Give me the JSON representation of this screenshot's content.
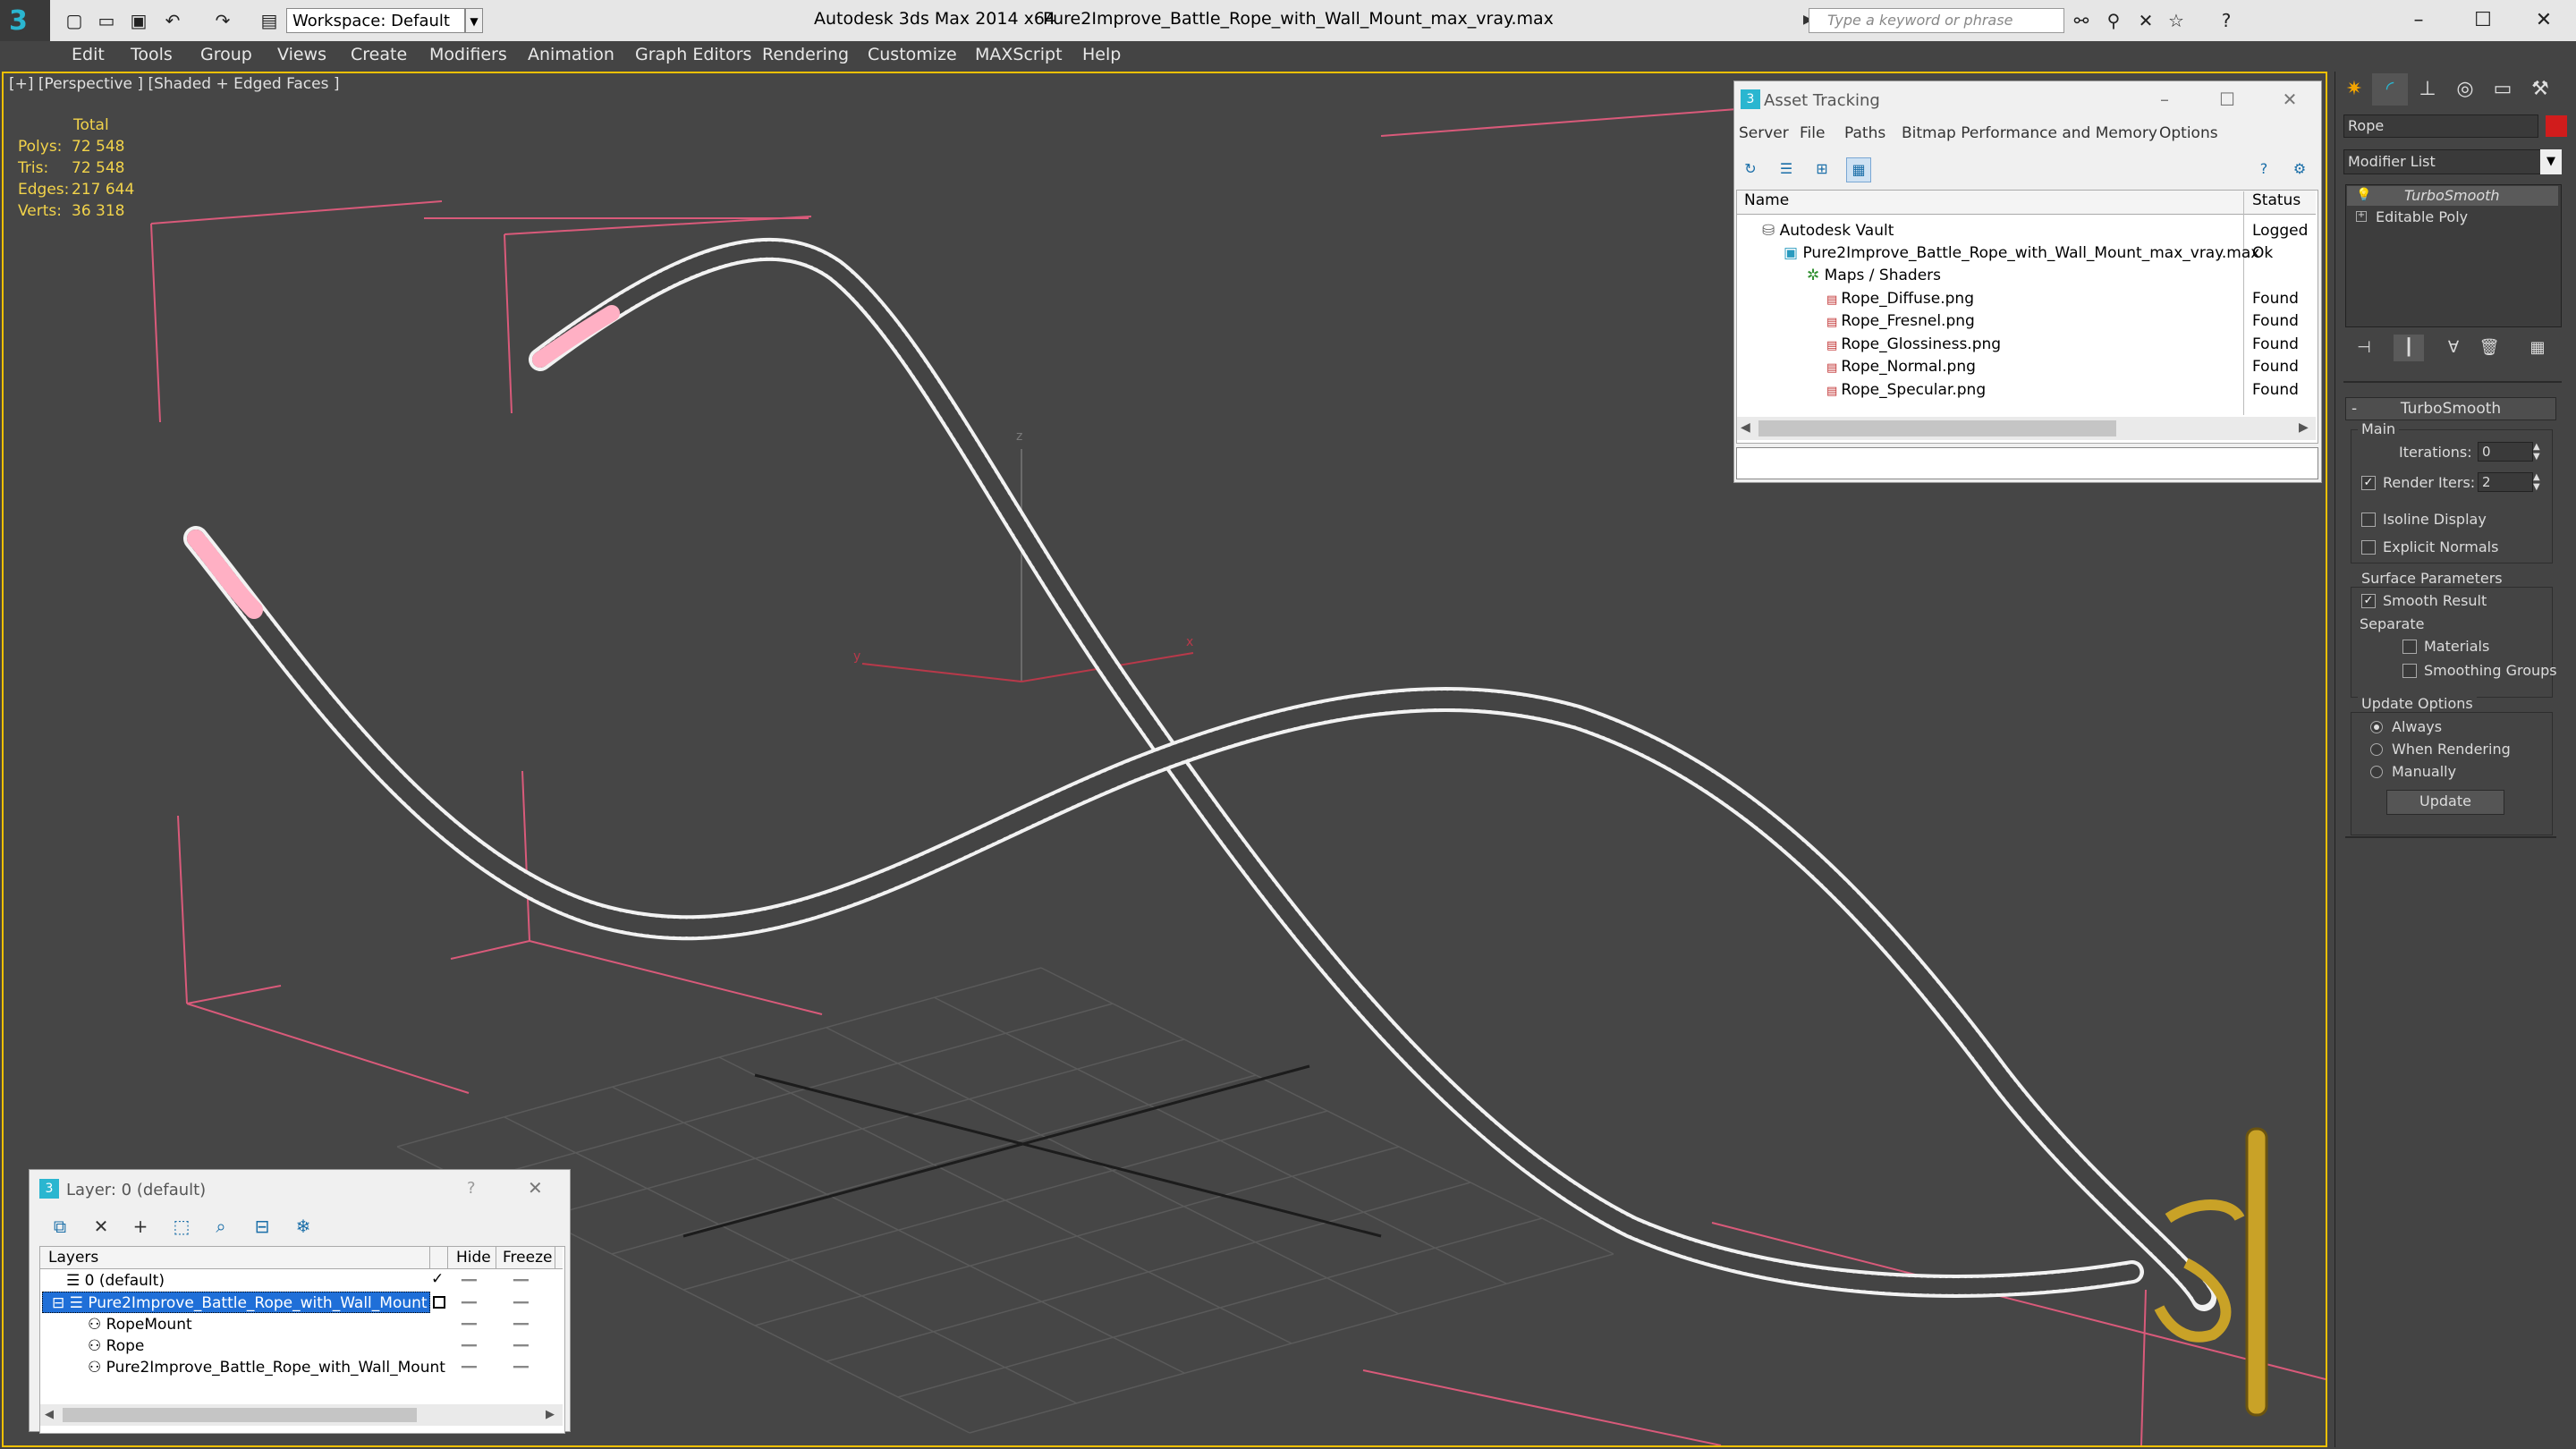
{
  "titlebar": {
    "workspace": "Workspace: Default",
    "app_title": "Autodesk 3ds Max  2014 x64",
    "file_title": "Pure2Improve_Battle_Rope_with_Wall_Mount_max_vray.max",
    "search_placeholder": "Type a keyword or phrase"
  },
  "menu": [
    "Edit",
    "Tools",
    "Group",
    "Views",
    "Create",
    "Modifiers",
    "Animation",
    "Graph Editors",
    "Rendering",
    "Customize",
    "MAXScript",
    "Help"
  ],
  "viewport": {
    "label": "[+] [Perspective ] [Shaded + Edged Faces ]",
    "stats_header": "Total",
    "stats": [
      {
        "label": "Polys:",
        "value": "72 548"
      },
      {
        "label": "Tris:",
        "value": "72 548"
      },
      {
        "label": "Edges:",
        "value": "217 644"
      },
      {
        "label": "Verts:",
        "value": "36 318"
      }
    ],
    "axis_z": "z",
    "axis_y": "y",
    "axis_x": "x"
  },
  "asset_tracking": {
    "title": "Asset Tracking",
    "menus": [
      "Server",
      "File",
      "Paths",
      "Bitmap Performance and Memory",
      "Options"
    ],
    "col_name": "Name",
    "col_status": "Status",
    "rows": [
      {
        "name": "Autodesk Vault",
        "status": "Logged"
      },
      {
        "name": "Pure2Improve_Battle_Rope_with_Wall_Mount_max_vray.max",
        "status": "Ok"
      },
      {
        "name": "Maps / Shaders",
        "status": ""
      },
      {
        "name": "Rope_Diffuse.png",
        "status": "Found"
      },
      {
        "name": "Rope_Fresnel.png",
        "status": "Found"
      },
      {
        "name": "Rope_Glossiness.png",
        "status": "Found"
      },
      {
        "name": "Rope_Normal.png",
        "status": "Found"
      },
      {
        "name": "Rope_Specular.png",
        "status": "Found"
      }
    ]
  },
  "layer_window": {
    "title": "Layer: 0 (default)",
    "col_layers": "Layers",
    "col_hide": "Hide",
    "col_freeze": "Freeze",
    "rows": [
      {
        "name": "0 (default)"
      },
      {
        "name": "Pure2Improve_Battle_Rope_with_Wall_Mount"
      },
      {
        "name": "RopeMount"
      },
      {
        "name": "Rope"
      },
      {
        "name": "Pure2Improve_Battle_Rope_with_Wall_Mount"
      }
    ]
  },
  "command_panel": {
    "object_name": "Rope",
    "object_color": "#d11c1c",
    "modifier_list": "Modifier List",
    "stack": [
      "TurboSmooth",
      "Editable Poly"
    ],
    "rollout_title": "TurboSmooth",
    "main_label": "Main",
    "iterations_label": "Iterations:",
    "iterations_value": "0",
    "render_iters_label": "Render Iters:",
    "render_iters_value": "2",
    "isoline_label": "Isoline Display",
    "explicit_normals_label": "Explicit Normals",
    "surface_params_label": "Surface Parameters",
    "smooth_result_label": "Smooth Result",
    "separate_label": "Separate",
    "materials_label": "Materials",
    "smoothing_groups_label": "Smoothing Groups",
    "update_options_label": "Update Options",
    "always_label": "Always",
    "when_rendering_label": "When Rendering",
    "manually_label": "Manually",
    "update_button": "Update"
  },
  "colors": {
    "viewport_border": "#f0c000",
    "gizmo": "#d95a7a",
    "selection": "#1f6fd8"
  }
}
